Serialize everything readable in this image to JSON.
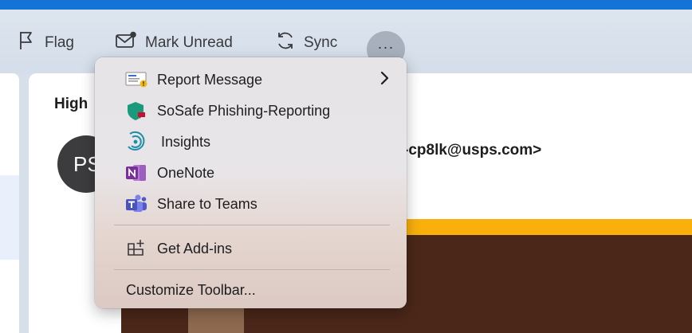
{
  "toolbar": {
    "flag_label": "Flag",
    "mark_unread_label": "Mark Unread",
    "sync_label": "Sync",
    "more_label": "···"
  },
  "message": {
    "subject_partial": "High",
    "avatar_initials": "PS",
    "sender_partial": "-cp8lk@usps.com>"
  },
  "menu": {
    "items": [
      {
        "label": "Report Message",
        "icon": "report-message-icon",
        "submenu": true
      },
      {
        "label": "SoSafe Phishing-Reporting",
        "icon": "sosafe-shield-icon"
      },
      {
        "label": "Insights",
        "icon": "insights-icon"
      },
      {
        "label": "OneNote",
        "icon": "onenote-icon"
      },
      {
        "label": "Share to Teams",
        "icon": "teams-icon"
      },
      {
        "label": "Get Add-ins",
        "icon": "add-ins-icon"
      },
      {
        "label": "Customize Toolbar...",
        "icon": ""
      }
    ]
  },
  "colors": {
    "accent": "#1473d6",
    "banner_yellow": "#f9b00b",
    "banner_brown": "#4a2719",
    "sosafe_green": "#1a9a7a",
    "onenote_purple": "#7a2f9e",
    "teams_purple": "#5059c9"
  }
}
